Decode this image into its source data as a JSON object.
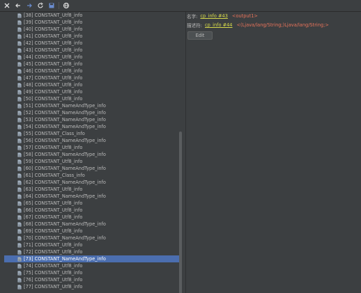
{
  "toolbar": {
    "buttons": [
      "close-icon",
      "back-arrow-icon",
      "forward-arrow-icon",
      "refresh-icon",
      "save-icon",
      "globe-icon"
    ]
  },
  "tree": {
    "items": [
      {
        "label": "[38] CONSTANT_Utf8_info"
      },
      {
        "label": "[39] CONSTANT_Utf8_info"
      },
      {
        "label": "[40] CONSTANT_Utf8_info"
      },
      {
        "label": "[41] CONSTANT_Utf8_info"
      },
      {
        "label": "[42] CONSTANT_Utf8_info"
      },
      {
        "label": "[43] CONSTANT_Utf8_info"
      },
      {
        "label": "[44] CONSTANT_Utf8_info"
      },
      {
        "label": "[45] CONSTANT_Utf8_info"
      },
      {
        "label": "[46] CONSTANT_Utf8_info"
      },
      {
        "label": "[47] CONSTANT_Utf8_info"
      },
      {
        "label": "[48] CONSTANT_Utf8_info"
      },
      {
        "label": "[49] CONSTANT_Utf8_info"
      },
      {
        "label": "[50] CONSTANT_Utf8_info"
      },
      {
        "label": "[51] CONSTANT_NameAndType_info"
      },
      {
        "label": "[52] CONSTANT_NameAndType_info"
      },
      {
        "label": "[53] CONSTANT_NameAndType_info"
      },
      {
        "label": "[54] CONSTANT_NameAndType_info"
      },
      {
        "label": "[55] CONSTANT_Class_info"
      },
      {
        "label": "[56] CONSTANT_NameAndType_info"
      },
      {
        "label": "[57] CONSTANT_Utf8_info"
      },
      {
        "label": "[58] CONSTANT_NameAndType_info"
      },
      {
        "label": "[59] CONSTANT_Utf8_info"
      },
      {
        "label": "[60] CONSTANT_NameAndType_info"
      },
      {
        "label": "[61] CONSTANT_Class_info"
      },
      {
        "label": "[62] CONSTANT_NameAndType_info"
      },
      {
        "label": "[63] CONSTANT_Utf8_info"
      },
      {
        "label": "[64] CONSTANT_NameAndType_info"
      },
      {
        "label": "[65] CONSTANT_Utf8_info"
      },
      {
        "label": "[66] CONSTANT_Utf8_info"
      },
      {
        "label": "[67] CONSTANT_Utf8_info"
      },
      {
        "label": "[68] CONSTANT_NameAndType_info"
      },
      {
        "label": "[69] CONSTANT_Utf8_info"
      },
      {
        "label": "[70] CONSTANT_NameAndType_info"
      },
      {
        "label": "[71] CONSTANT_Utf8_info"
      },
      {
        "label": "[72] CONSTANT_Utf8_info"
      },
      {
        "label": "[73] CONSTANT_NameAndType_info",
        "selected": true
      },
      {
        "label": "[74] CONSTANT_Utf8_info"
      },
      {
        "label": "[75] CONSTANT_Utf8_info"
      },
      {
        "label": "[76] CONSTANT_Utf8_info"
      },
      {
        "label": "[77] CONSTANT_Utf8_info"
      }
    ]
  },
  "detail": {
    "name_label": "名字:",
    "name_link": "cp_info #43",
    "name_value": "<output1>",
    "descriptor_label": "描述符:",
    "descriptor_link": "cp_info #44",
    "descriptor_value": "<(Ljava/lang/String;)Ljava/lang/String;>",
    "edit_button": "Edit"
  },
  "colors": {
    "background": "#3c3f41",
    "selection": "#4b6eaf",
    "link": "#d6d94a",
    "value": "#e8735a",
    "text": "#bbbbbb"
  }
}
